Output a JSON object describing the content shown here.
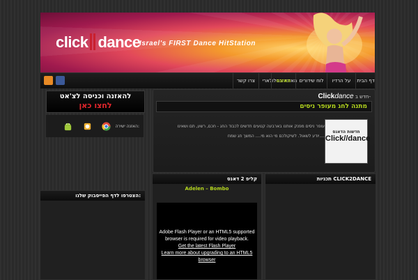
{
  "header": {
    "logo_left": "click",
    "logo_right": "dance",
    "tagline": "Israel's FIRST Dance HitStation"
  },
  "nav": {
    "items": [
      {
        "label": "צרו קשר"
      },
      {
        "label": "האזנה בסלולארי"
      },
      {
        "label": "האזנה",
        "active": true
      },
      {
        "label": "לוח שידורים"
      },
      {
        "label": "על הרדיו"
      },
      {
        "label": "דף הבית"
      }
    ],
    "social": [
      "rss-icon",
      "facebook-icon"
    ]
  },
  "news": {
    "label_prefix": "חדש ב-",
    "label_brand": "Click",
    "label_brand2": "dance",
    "headline": "מתנה לחג מעופר ניסים",
    "body_line1": "עופר ניסים מפנק אותנו בארבעה קטעים חדשים לכבוד החג - חכם, רשע, תם ושאינו",
    "body_line2": "יודע לשאול. לשיקולכם מי הוא מי.... המשך חג שמח....",
    "thumb_line1": "חדשות הדאנס",
    "thumb_line2": "Click//dance"
  },
  "promo": {
    "line1": "להאזנה וכניסה לצ'אט",
    "line2": "לחצו כאן"
  },
  "listen": {
    "label": "האזנה ישירה:",
    "apps": [
      "android-icon",
      "ios-icon",
      "chrome-icon"
    ]
  },
  "panels": {
    "facebook_title": "הצטרפו לדף הפייסבוק שלנו:",
    "clip_title": "קליפ 2 דאנס",
    "clip_name": "Adelen – Bombo",
    "radio_title": "תכניות CLICK2DANCE"
  },
  "video": {
    "line1": "Adobe Flash Player or an HTML5 supported",
    "line2": "browser is required for video playback.",
    "link1": "Get the latest Flash Player",
    "link2": "Learn more about upgrading to an HTML5",
    "link2b": "browser"
  },
  "colors": {
    "accent_green": "#b4d61e",
    "promo_red": "#e3262c",
    "background": "#2b2b2b"
  }
}
